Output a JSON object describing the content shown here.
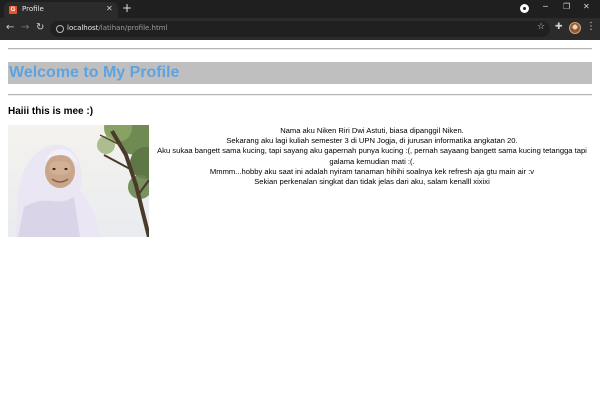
{
  "browser": {
    "tab": {
      "title": "Profile",
      "favicon_letter": "G",
      "close_glyph": "✕"
    },
    "new_tab_glyph": "+",
    "window_controls": {
      "minimize": "─",
      "restore": "❐",
      "close": "✕"
    },
    "nav": {
      "back": "←",
      "forward": "→",
      "reload": "↻"
    },
    "address_bar": {
      "host": "localhost",
      "path": "/latihan/profile.html"
    },
    "toolbar_icons": {
      "bookmark": "☆",
      "extensions": "✚",
      "menu": "⋮"
    }
  },
  "page": {
    "heading": "Welcome to My Profile",
    "subheading": "Haiii this is mee :)",
    "bio_lines": [
      "Nama aku Niken Riri Dwi Astuti, biasa dipanggil Niken.",
      "Sekarang aku lagi kuliah semester 3 di UPN Jogja, di jurusan informatika angkatan 20.",
      "Aku sukaa bangett sama kucing, tapi sayang aku gapernah punya kucing :(, pernah sayaang bangett sama kucing tetangga tapi galama kemudian mati :(.",
      "Mmmm...hobby aku saat ini adalah nyiram tanaman hihihi soalnya kek refresh aja gtu main air :v",
      "Sekian perkenalan singkat dan tidak jelas dari aku, salam kenalll xixixi"
    ]
  },
  "colors": {
    "heading_text": "#5ea3e0",
    "heading_bg": "#c0bfbf",
    "chrome_dark": "#1f1f1f",
    "toolbar": "#2b2b2b"
  }
}
